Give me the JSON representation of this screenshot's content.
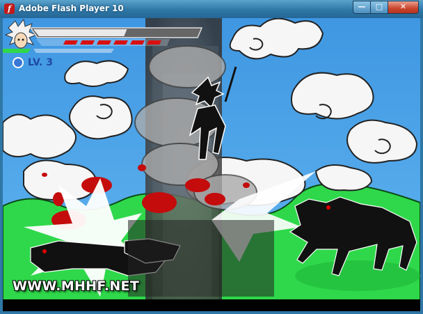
{
  "window": {
    "title": "Adobe Flash Player 10",
    "app_icon": "flash-player-icon",
    "controls": {
      "minimize": "minimize-icon",
      "maximize": "maximize-icon",
      "close": "close-icon"
    }
  },
  "hud": {
    "level_label": "LV. 3",
    "health_fraction": 0.56,
    "special_fraction": 0.62,
    "special_segments_red": 6
  },
  "watermark": "WWW.MHHF.NET",
  "colors": {
    "sky": "#4fa7e8",
    "grass": "#2fd84a",
    "blood": "#c40c0c",
    "title_bar": "#2f77a6"
  }
}
